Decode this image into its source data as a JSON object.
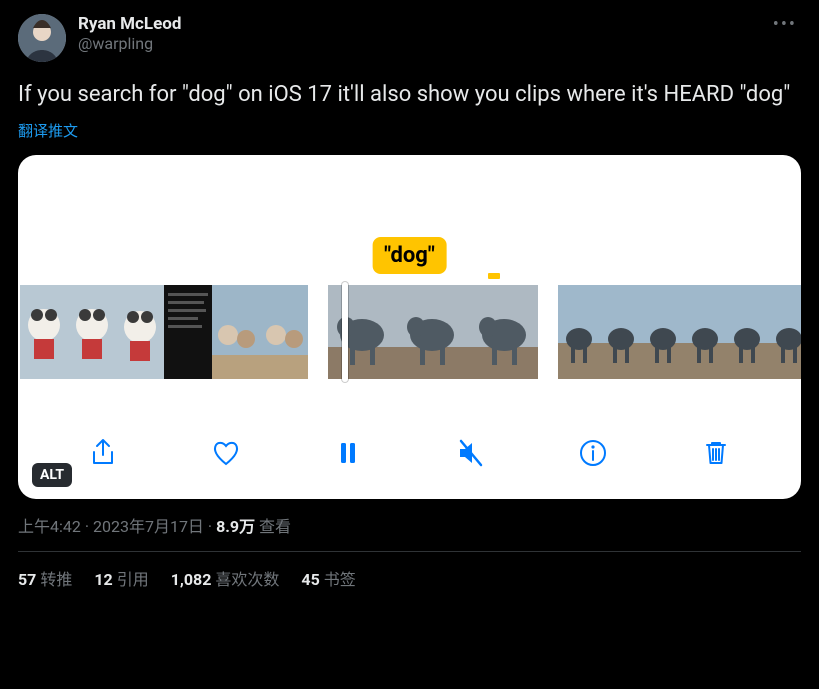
{
  "author": {
    "display_name": "Ryan McLeod",
    "handle": "@warpling"
  },
  "tweet_text": "If you search for \"dog\" on iOS 17 it'll also show you clips where it's HEARD \"dog\"",
  "translate_label": "翻译推文",
  "media": {
    "tooltip_text": "\"dog\"",
    "alt_badge": "ALT",
    "toolbar": {
      "share": "share",
      "like": "like",
      "pause": "pause",
      "mute": "mute",
      "info": "info",
      "delete": "delete"
    }
  },
  "meta": {
    "time": "上午4:42",
    "dot1": " · ",
    "date": "2023年7月17日",
    "dot2": " · ",
    "views_number": "8.9万",
    "views_label": " 查看"
  },
  "stats": {
    "retweets_num": "57",
    "retweets_label": "转推",
    "quotes_num": "12",
    "quotes_label": "引用",
    "likes_num": "1,082",
    "likes_label": "喜欢次数",
    "bookmarks_num": "45",
    "bookmarks_label": "书签"
  }
}
